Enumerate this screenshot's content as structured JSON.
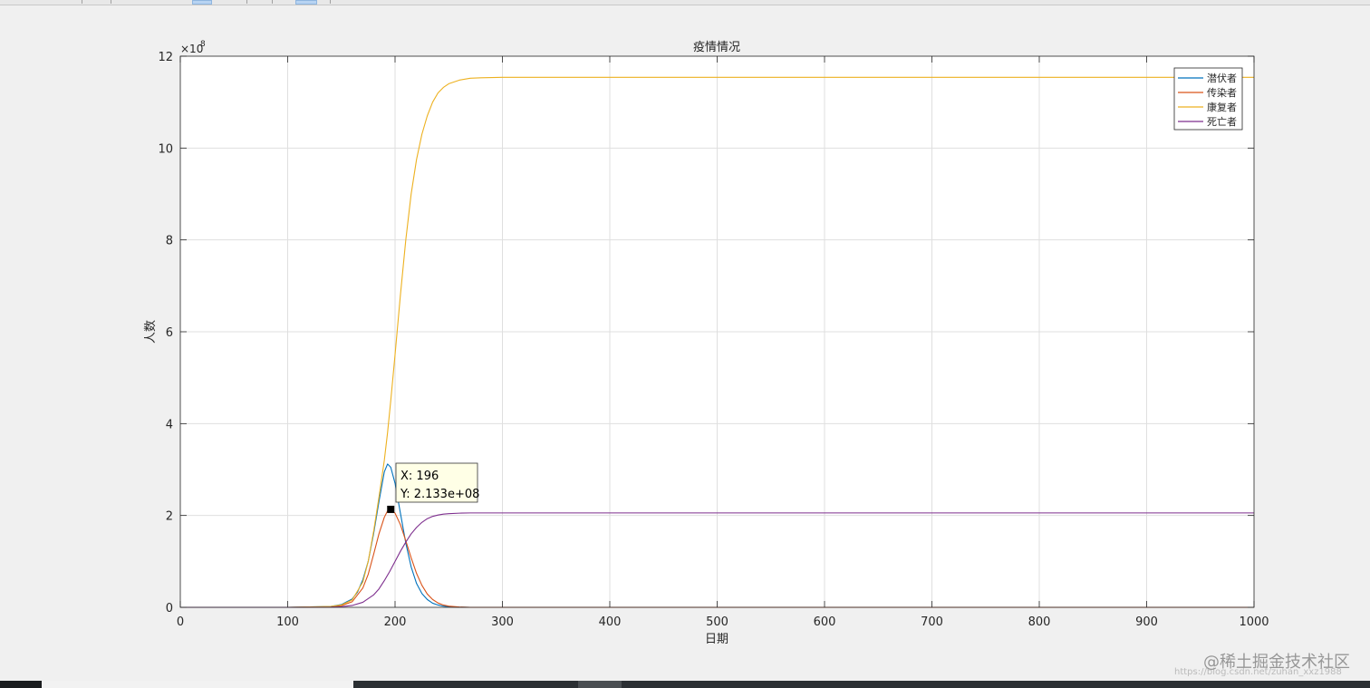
{
  "window": {
    "watermark": "@稀土掘金技术社区",
    "watermark_url": "https://blog.csdn.net/zuhan_xxz1988"
  },
  "colors": {
    "latent": "#0072bd",
    "infected": "#d95319",
    "recovered": "#edb120",
    "dead": "#7e2f8e",
    "grid": "#dfdfdf",
    "axis": "#262626"
  },
  "chart_data": {
    "type": "line",
    "title": "疫情情况",
    "xlabel": "日期",
    "ylabel": "人数",
    "xlim": [
      0,
      1000
    ],
    "ylim": [
      0,
      1200000000
    ],
    "y_exponent_label": "×10",
    "y_exponent": "8",
    "xticks": [
      0,
      100,
      200,
      300,
      400,
      500,
      600,
      700,
      800,
      900,
      1000
    ],
    "yticks": [
      0,
      2,
      4,
      6,
      8,
      10,
      12
    ],
    "grid": true,
    "legend_position": "top-right",
    "series": [
      {
        "name": "潜伏者",
        "color": "#0072bd",
        "x": [
          0,
          100,
          140,
          150,
          160,
          165,
          170,
          175,
          180,
          185,
          190,
          193,
          196,
          200,
          205,
          210,
          215,
          220,
          225,
          230,
          235,
          240,
          245,
          250,
          260,
          270,
          300,
          1000
        ],
        "y": [
          0,
          0,
          2000000,
          6000000,
          18000000,
          33000000,
          60000000,
          100000000,
          160000000,
          230000000,
          295000000,
          312000000,
          305000000,
          270000000,
          205000000,
          140000000,
          88000000,
          52000000,
          30000000,
          17000000,
          9000000,
          5000000,
          2500000,
          1200000,
          300000,
          0,
          0,
          0
        ]
      },
      {
        "name": "传染者",
        "color": "#d95319",
        "x": [
          0,
          100,
          140,
          150,
          160,
          170,
          175,
          180,
          185,
          190,
          193,
          196,
          200,
          205,
          210,
          215,
          220,
          225,
          230,
          235,
          240,
          245,
          250,
          260,
          270,
          300,
          1000
        ],
        "y": [
          0,
          0,
          1000000,
          3500000,
          12000000,
          42000000,
          72000000,
          115000000,
          160000000,
          196000000,
          210000000,
          213300000,
          205000000,
          180000000,
          145000000,
          108000000,
          74000000,
          48000000,
          29000000,
          17000000,
          9500000,
          5000000,
          2600000,
          600000,
          0,
          0,
          0
        ]
      },
      {
        "name": "康复者",
        "color": "#edb120",
        "x": [
          0,
          100,
          140,
          150,
          160,
          170,
          175,
          180,
          185,
          190,
          193,
          196,
          200,
          205,
          210,
          215,
          220,
          225,
          230,
          235,
          240,
          245,
          250,
          260,
          270,
          280,
          300,
          1000
        ],
        "y": [
          0,
          0,
          2000000,
          5000000,
          16000000,
          55000000,
          100000000,
          165000000,
          240000000,
          320000000,
          380000000,
          450000000,
          550000000,
          680000000,
          800000000,
          900000000,
          975000000,
          1030000000,
          1070000000,
          1100000000,
          1120000000,
          1132000000,
          1140000000,
          1148000000,
          1152000000,
          1153000000,
          1154000000,
          1154000000
        ]
      },
      {
        "name": "死亡者",
        "color": "#7e2f8e",
        "x": [
          0,
          100,
          140,
          150,
          160,
          170,
          180,
          185,
          190,
          195,
          200,
          205,
          210,
          215,
          220,
          225,
          230,
          235,
          240,
          245,
          250,
          260,
          270,
          1000
        ],
        "y": [
          0,
          0,
          500000,
          1500000,
          4000000,
          11000000,
          27000000,
          40000000,
          58000000,
          78000000,
          100000000,
          122000000,
          142000000,
          160000000,
          174000000,
          185000000,
          193000000,
          198000000,
          201000000,
          203000000,
          204000000,
          205000000,
          205500000,
          205500000
        ]
      }
    ],
    "datatip": {
      "x": 196,
      "y": 213300000,
      "x_text": "X: 196",
      "y_text": "Y: 2.133e+08"
    }
  }
}
